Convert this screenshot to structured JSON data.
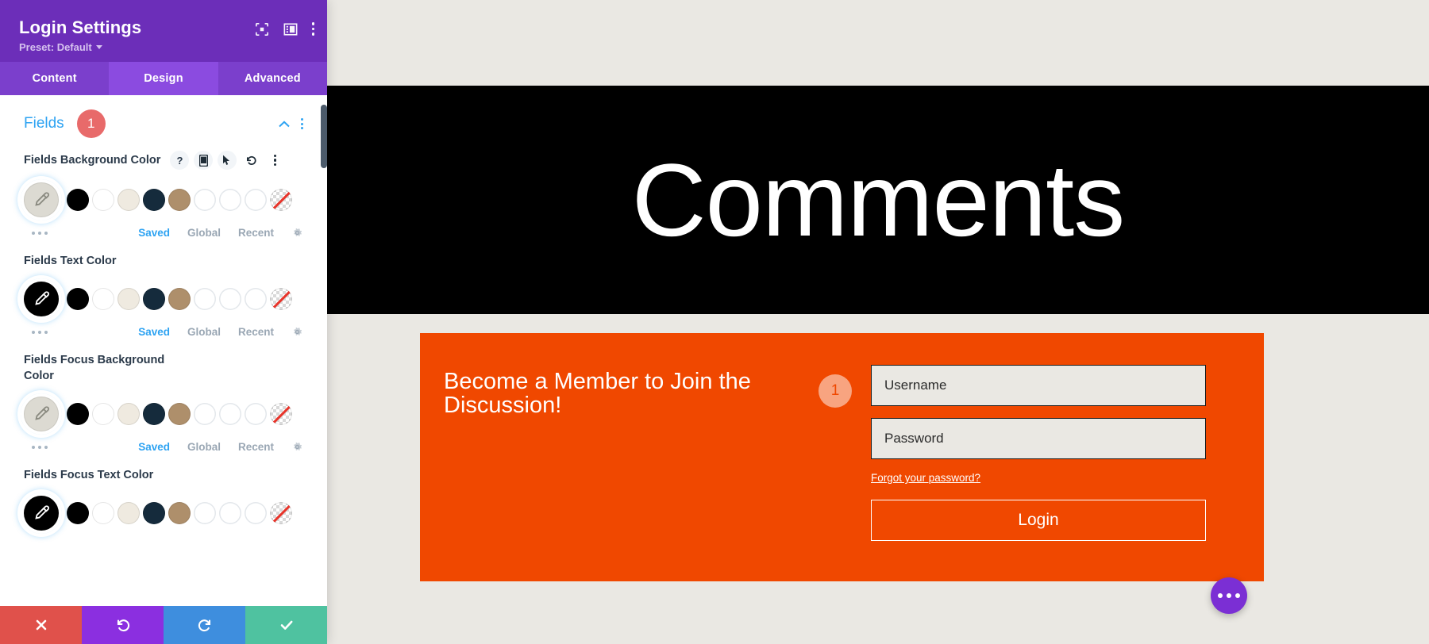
{
  "panel": {
    "title": "Login Settings",
    "preset_label": "Preset: Default",
    "header_icons": [
      {
        "name": "focus-target-icon"
      },
      {
        "name": "layout-panel-icon"
      },
      {
        "name": "kebab-menu-icon"
      }
    ],
    "tabs": [
      {
        "label": "Content",
        "active": false
      },
      {
        "label": "Design",
        "active": true
      },
      {
        "label": "Advanced",
        "active": false
      }
    ],
    "section": {
      "title": "Fields",
      "badge": "1"
    },
    "palette": [
      {
        "name": "black",
        "hex": "#000000"
      },
      {
        "name": "white",
        "hex": "#FFFFFF"
      },
      {
        "name": "cream",
        "hex": "#EFEAE0"
      },
      {
        "name": "dark-navy",
        "hex": "#152B3C"
      },
      {
        "name": "tan",
        "hex": "#AE8F6B"
      },
      {
        "name": "empty-1",
        "hex": ""
      },
      {
        "name": "empty-2",
        "hex": ""
      },
      {
        "name": "empty-3",
        "hex": ""
      },
      {
        "name": "transparent",
        "hex": "transparent"
      }
    ],
    "meta_links": [
      {
        "label": "Saved",
        "active": true
      },
      {
        "label": "Global",
        "active": false
      },
      {
        "label": "Recent",
        "active": false
      }
    ],
    "help_icon_label": "?",
    "fields": [
      {
        "label": "Fields Background Color",
        "current_hex": "#DCDAD2",
        "show_icons": true,
        "eyedropper": "light"
      },
      {
        "label": "Fields Text Color",
        "current_hex": "#000000",
        "show_icons": false,
        "eyedropper": "dark"
      },
      {
        "label": "Fields Focus Background Color",
        "current_hex": "#DCDAD2",
        "show_icons": false,
        "eyedropper": "light"
      },
      {
        "label": "Fields Focus Text Color",
        "current_hex": "#000000",
        "show_icons": false,
        "eyedropper": "dark"
      }
    ],
    "actions": [
      {
        "name": "cancel-button",
        "icon": "close-icon",
        "color": "#E0514B"
      },
      {
        "name": "undo-button",
        "icon": "undo-icon",
        "color": "#8B2FE0"
      },
      {
        "name": "redo-button",
        "icon": "redo-icon",
        "color": "#3E8EDE"
      },
      {
        "name": "save-button",
        "icon": "checkmark-icon",
        "color": "#4FC2A0"
      }
    ]
  },
  "preview": {
    "hero_title": "Comments",
    "login_module": {
      "heading": "Become a Member to Join the Discussion!",
      "badge": "1",
      "username_placeholder": "Username",
      "password_placeholder": "Password",
      "forgot_link": "Forgot your password?",
      "login_button": "Login",
      "background_hex": "#F04800"
    },
    "fab_label": "more-options"
  }
}
